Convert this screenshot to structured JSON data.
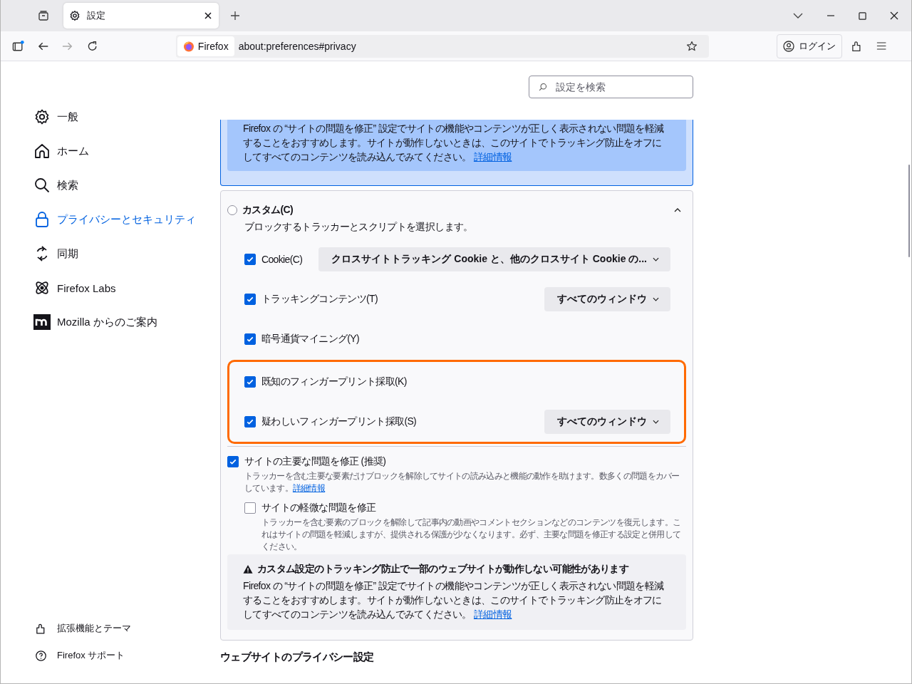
{
  "tabs": [
    {
      "title": "設定",
      "selected": true
    }
  ],
  "toolbar": {
    "identity": "Firefox",
    "url": "about:preferences#privacy",
    "login": "ログイン"
  },
  "search": {
    "placeholder": "設定を検索"
  },
  "sidebar": {
    "items": [
      {
        "label": "一般",
        "selected": false
      },
      {
        "label": "ホーム",
        "selected": false
      },
      {
        "label": "検索",
        "selected": false
      },
      {
        "label": "プライバシーとセキュリティ",
        "selected": true
      },
      {
        "label": "同期",
        "selected": false
      },
      {
        "label": "Firefox Labs",
        "selected": false
      },
      {
        "label": "Mozilla からのご案内",
        "selected": false
      }
    ],
    "footer": [
      {
        "label": "拡張機能とテーマ"
      },
      {
        "label": "Firefox サポート"
      }
    ]
  },
  "standard_notice": {
    "text": "Firefox の “サイトの問題を修正” 設定でサイトの機能やコンテンツが正しく表示されない問題を軽減することをおすすめします。サイトが動作しないときは、このサイトでトラッキング防止をオフにしてすべてのコンテンツを読み込んでみてください。",
    "link": "詳細情報"
  },
  "custom": {
    "label": "カスタム(C)",
    "selected": false,
    "expanded": true,
    "description": "ブロックするトラッカーとスクリプトを選択します。",
    "options": [
      {
        "label": "Cookie(C)",
        "checked": true,
        "dropdown": "クロスサイトトラッキング Cookie と、他のクロスサイト Cookie の..."
      },
      {
        "label": "トラッキングコンテンツ(T)",
        "checked": true,
        "dropdown": "すべてのウィンドウ"
      },
      {
        "label": "暗号通貨マイニング(Y)",
        "checked": true
      }
    ],
    "highlighted_options": [
      {
        "label": "既知のフィンガープリント採取(K)",
        "checked": true
      },
      {
        "label": "疑わしいフィンガープリント採取(S)",
        "checked": true,
        "dropdown": "すべてのウィンドウ"
      }
    ],
    "fixes": [
      {
        "label": "サイトの主要な問題を修正 (推奨)",
        "checked": true,
        "description": "トラッカーを含む主要な要素だけブロックを解除してサイトの読み込みと機能の動作を助けます。数多くの問題をカバーしています。",
        "link": "詳細情報"
      },
      {
        "label": "サイトの軽微な問題を修正",
        "checked": false,
        "description": "トラッカーを含む要素のブロックを解除して記事内の動画やコメントセクションなどのコンテンツを復元します。これはサイトの問題を軽減しますが、提供される保護が少なくなります。必ず、主要な問題を修正する設定と併用してください。"
      }
    ],
    "warning": {
      "title": "カスタム設定のトラッキング防止で一部のウェブサイトが動作しない可能性があります",
      "text": "Firefox の “サイトの問題を修正” 設定でサイトの機能やコンテンツが正しく表示されない問題を軽減することをおすすめします。サイトが動作しないときは、このサイトでトラッキング防止をオフにしてすべてのコンテンツを読み込んでみてください。",
      "link": "詳細情報"
    }
  },
  "section_heading": "ウェブサイトのプライバシー設定"
}
